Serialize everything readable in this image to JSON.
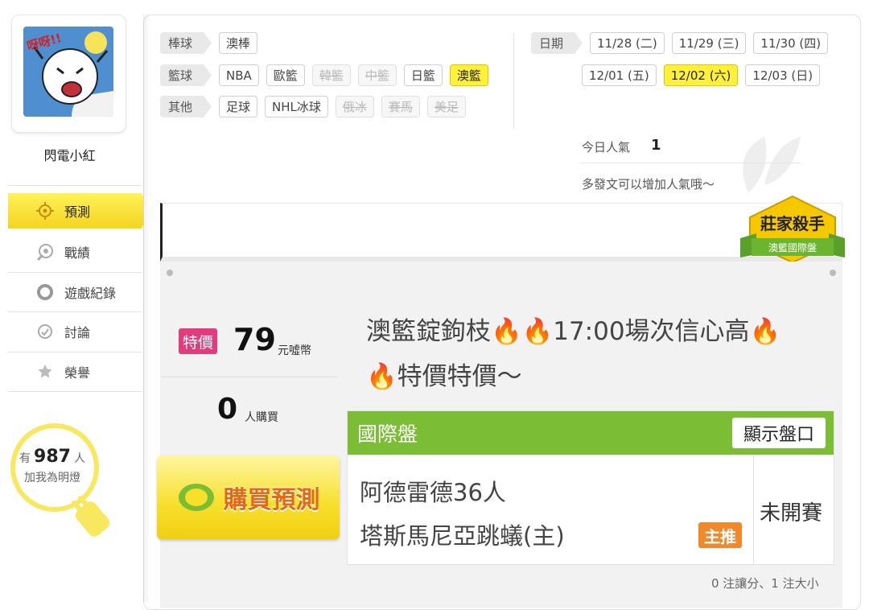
{
  "user": {
    "name": "閃電小紅",
    "avatar_text": "呀呀!!"
  },
  "nav": [
    {
      "label": "預測",
      "icon": "target-icon",
      "active": true
    },
    {
      "label": "戰績",
      "icon": "chart-icon"
    },
    {
      "label": "遊戲紀錄",
      "icon": "record-icon"
    },
    {
      "label": "討論",
      "icon": "discussion-icon"
    },
    {
      "label": "榮譽",
      "icon": "medal-icon"
    }
  ],
  "fans": {
    "prefix": "有",
    "count": "987",
    "suffix": "人",
    "line2": "加我為明燈"
  },
  "categories": {
    "baseball": {
      "label": "棒球",
      "items": [
        "澳棒"
      ]
    },
    "basketball": {
      "label": "籃球",
      "items": [
        "NBA",
        "歐籃",
        "韓籃",
        "中籃",
        "日籃",
        "澳籃"
      ]
    },
    "other": {
      "label": "其他",
      "items": [
        "足球",
        "NHL冰球",
        "俄冰",
        "賽馬",
        "美足"
      ]
    }
  },
  "dates": {
    "label": "日期",
    "items": [
      "11/28 (二)",
      "11/29 (三)",
      "11/30 (四)",
      "12/01 (五)",
      "12/02 (六)",
      "12/03 (日)"
    ]
  },
  "popularity": {
    "label": "今日人氣",
    "value": "1",
    "hint": "多發文可以增加人氣哦～"
  },
  "badge": {
    "title": "莊家殺手",
    "subtitle": "澳籃國際盤"
  },
  "prediction": {
    "price_tag": "特價",
    "price": "79",
    "price_unit": "元噓幣",
    "buyers": "0",
    "buyers_unit": "人購買",
    "buy_button": "購買預測",
    "title_part1": "澳籃錠鉤枝",
    "title_part2": "17:00場次信心高",
    "title_part3": "特價特價～",
    "fire": "🔥"
  },
  "card": {
    "header": "國際盤",
    "show_button": "顯示盤口",
    "away_team": "阿德雷德36人",
    "home_team": "塔斯馬尼亞跳蟻(主)",
    "recommend_tag": "主推",
    "status": "未開賽",
    "footnote": "0 注讓分、1 注大小"
  },
  "colors": {
    "accent_yellow": "#fff03a",
    "green": "#7bbd35",
    "pink": "#e23c7c",
    "orange": "#f0892a"
  }
}
